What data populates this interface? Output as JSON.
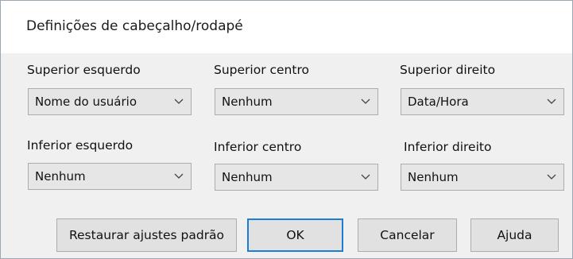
{
  "dialog": {
    "title": "Definições de cabeçalho/rodapé"
  },
  "fields": {
    "top_left": {
      "label": "Superior esquerdo",
      "value": "Nome do usuário"
    },
    "top_center": {
      "label": "Superior centro",
      "value": "Nenhum"
    },
    "top_right": {
      "label": "Superior direito",
      "value": "Data/Hora"
    },
    "bottom_left": {
      "label": "Inferior esquerdo",
      "value": "Nenhum"
    },
    "bottom_center": {
      "label": "Inferior centro",
      "value": "Nenhum"
    },
    "bottom_right": {
      "label": "Inferior direito",
      "value": "Nenhum"
    }
  },
  "buttons": {
    "restore": "Restaurar ajustes padrão",
    "ok": "OK",
    "cancel": "Cancelar",
    "help": "Ajuda"
  },
  "colors": {
    "default_button_border": "#1e7bd6"
  }
}
